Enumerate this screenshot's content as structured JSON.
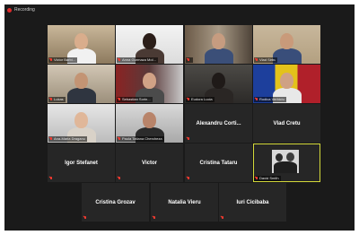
{
  "recording": {
    "label": "Recording",
    "color": "#e02b2b"
  },
  "accent": {
    "active_speaker": "#d4d93a",
    "muted": "#ff3b30"
  },
  "participants": [
    {
      "name": "Victor Barbi...",
      "type": "video",
      "scene": "office",
      "muted": true
    },
    {
      "name": "Anna Gurmaza Mol...",
      "type": "video",
      "scene": "light",
      "muted": true
    },
    {
      "name": "",
      "type": "video",
      "scene": "bookshelf",
      "muted": true
    },
    {
      "name": "Vlad Sirbu",
      "type": "video",
      "scene": "wall",
      "muted": true
    },
    {
      "name": "Lukas",
      "type": "video",
      "scene": "room",
      "muted": true
    },
    {
      "name": "Sebastian Sorin...",
      "type": "video",
      "scene": "red",
      "muted": true
    },
    {
      "name": "Eudora Lucia",
      "type": "video",
      "scene": "dark",
      "muted": true
    },
    {
      "name": "Rodica Verbiciu",
      "type": "video",
      "scene": "flag",
      "muted": true
    },
    {
      "name": "Ana-Maria Draganu",
      "type": "video",
      "scene": "window",
      "muted": true
    },
    {
      "name": "Paula Tatiana Chercheza",
      "type": "video",
      "scene": "office2",
      "muted": true
    },
    {
      "name": "Alexandru Corti...",
      "type": "name",
      "muted": true
    },
    {
      "name": "Vlad Cretu",
      "type": "name",
      "muted": false
    },
    {
      "name": "Igor Stefanet",
      "type": "name",
      "muted": true
    },
    {
      "name": "Victor",
      "type": "name",
      "muted": true
    },
    {
      "name": "Cristina Tataru",
      "type": "name",
      "muted": true
    },
    {
      "name": "David Smith",
      "type": "photo",
      "muted": true,
      "active": true
    },
    {
      "name": "Cristina Grozav",
      "type": "name",
      "muted": true
    },
    {
      "name": "Natalia Vieru",
      "type": "name",
      "muted": true
    },
    {
      "name": "Iuri Cicibaba",
      "type": "name",
      "muted": true
    }
  ]
}
